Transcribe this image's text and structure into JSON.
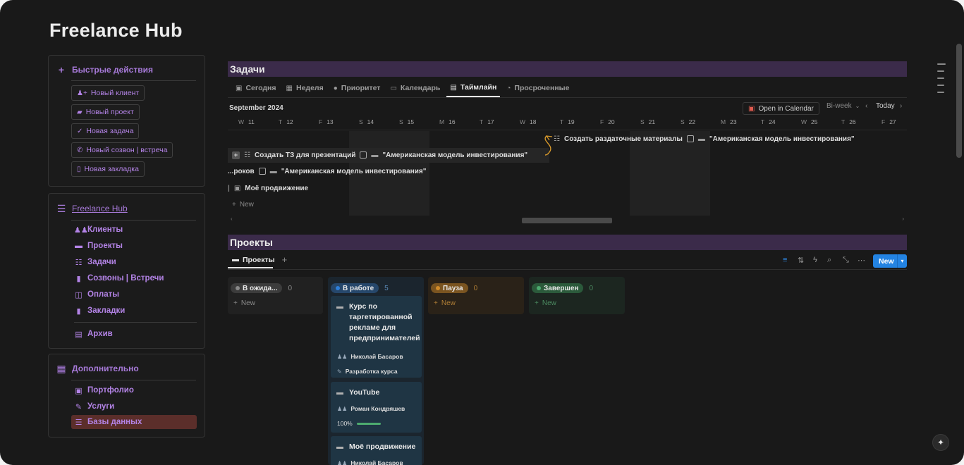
{
  "page": {
    "title": "Freelance Hub"
  },
  "quick_actions": {
    "title": "Быстрые действия",
    "buttons": [
      {
        "label": "Новый клиент",
        "icon": "add-person-icon"
      },
      {
        "label": "Новый проект",
        "icon": "folder-icon"
      },
      {
        "label": "Новая задача",
        "icon": "check-icon"
      },
      {
        "label": "Новый созвон | встреча",
        "icon": "phone-icon"
      },
      {
        "label": "Новая закладка",
        "icon": "bookmark-icon"
      }
    ]
  },
  "hub_nav": {
    "title": "Freelance Hub",
    "items": [
      {
        "label": "Клиенты",
        "icon": "people-icon"
      },
      {
        "label": "Проекты",
        "icon": "folder-icon"
      },
      {
        "label": "Задачи",
        "icon": "checklist-icon"
      },
      {
        "label": "Созвоны | Встречи",
        "icon": "phone-icon"
      },
      {
        "label": "Оплаты",
        "icon": "money-icon"
      },
      {
        "label": "Закладки",
        "icon": "bookmark-icon"
      },
      {
        "label": "Архив",
        "icon": "archive-icon"
      }
    ]
  },
  "extra_nav": {
    "title": "Дополнительно",
    "items": [
      {
        "label": "Портфолио",
        "icon": "id-card-icon"
      },
      {
        "label": "Услуги",
        "icon": "wrench-icon"
      },
      {
        "label": "Базы данных",
        "icon": "database-icon",
        "active": true
      }
    ]
  },
  "tasks": {
    "header": "Задачи",
    "tabs": [
      {
        "label": "Сегодня",
        "icon": "today-icon"
      },
      {
        "label": "Неделя",
        "icon": "calendar-icon"
      },
      {
        "label": "Приоритет",
        "icon": "alert-icon"
      },
      {
        "label": "Календарь",
        "icon": "calendar-icon"
      },
      {
        "label": "Таймлайн",
        "icon": "timeline-icon",
        "active": true
      },
      {
        "label": "Просроченные",
        "icon": "clock-icon"
      }
    ],
    "timeline": {
      "month": "September 2024",
      "open_calendar": "Open in Calendar",
      "range": "Bi-week",
      "today": "Today",
      "days": [
        {
          "wd": "W",
          "d": "11"
        },
        {
          "wd": "T",
          "d": "12"
        },
        {
          "wd": "F",
          "d": "13"
        },
        {
          "wd": "S",
          "d": "14"
        },
        {
          "wd": "S",
          "d": "15"
        },
        {
          "wd": "M",
          "d": "16"
        },
        {
          "wd": "T",
          "d": "17"
        },
        {
          "wd": "W",
          "d": "18"
        },
        {
          "wd": "T",
          "d": "19"
        },
        {
          "wd": "F",
          "d": "20"
        },
        {
          "wd": "S",
          "d": "21"
        },
        {
          "wd": "S",
          "d": "22"
        },
        {
          "wd": "M",
          "d": "23"
        },
        {
          "wd": "T",
          "d": "24"
        },
        {
          "wd": "W",
          "d": "25"
        },
        {
          "wd": "T",
          "d": "26"
        },
        {
          "wd": "F",
          "d": "27"
        }
      ],
      "rows": [
        {
          "title": "Создать раздаточные материалы",
          "project": "\"Американская модель инвестирования\""
        },
        {
          "title": "Создать ТЗ для презентаций",
          "project": "\"Американская модель инвестирования\""
        },
        {
          "title": "...роков",
          "project": "\"Американская модель инвестирования\""
        },
        {
          "title": "Моё продвижение",
          "project": ""
        }
      ],
      "new_label": "New"
    }
  },
  "projects": {
    "header": "Проекты",
    "view_tab": "Проекты",
    "new_button": "New",
    "columns": [
      {
        "label": "В ожида...",
        "count": "0",
        "color": "#8a8a8a",
        "pill_bg": "#3c3c3c",
        "col_bg": "#212121",
        "new_color": "#8a8a8a"
      },
      {
        "label": "В работе",
        "count": "5",
        "color": "#2e7fd9",
        "pill_bg": "#26476b",
        "col_bg": "#1b252e",
        "new_color": "#5b8ab8"
      },
      {
        "label": "Пауза",
        "count": "0",
        "color": "#d08b2a",
        "pill_bg": "#7a5420",
        "col_bg": "#2a2218",
        "new_color": "#b07e35"
      },
      {
        "label": "Завершен",
        "count": "0",
        "color": "#4dab6f",
        "pill_bg": "#2b5a3b",
        "col_bg": "#1c2620",
        "new_color": "#4b8a60"
      }
    ],
    "new_label": "New",
    "cards": [
      {
        "title": "Курс по таргетированной рекламе для предпринимателей",
        "person": "Николай Басаров",
        "service": "Разработка курса"
      },
      {
        "title": "YouTube",
        "person": "Роман Кондряшев",
        "progress": "100%"
      },
      {
        "title": "Моё продвижение",
        "person": "Николай Басаров"
      }
    ]
  }
}
